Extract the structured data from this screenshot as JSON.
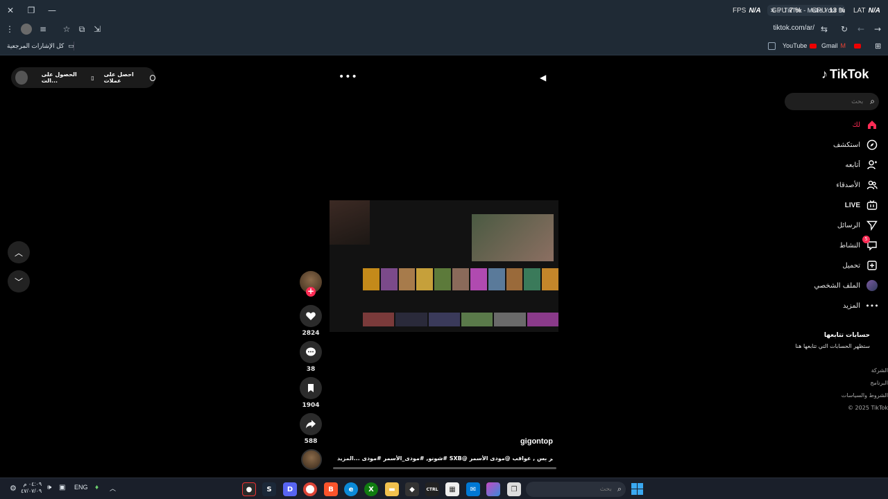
{
  "window": {
    "tab_title": "TikTok - Make Your Day",
    "overlay": {
      "fps_label": "FPS",
      "fps_value": "N/A",
      "gpu_label": "GPU",
      "gpu_value": "7 %",
      "cpu_label": "CPU",
      "cpu_value": "13 %",
      "lat_label": "LAT",
      "lat_value": "N/A"
    }
  },
  "toolbar": {
    "url": "tiktok.com/ar/"
  },
  "bookmarks": {
    "all_bookmarks": "كل الإشارات المرجعية",
    "youtube": "YouTube",
    "gmail": "Gmail"
  },
  "tiktok": {
    "logo": "TikTok",
    "search_placeholder": "بحث",
    "promo": {
      "get_coins": "احصل على عملات",
      "get_app": "الحصول على الت..."
    },
    "nav": [
      {
        "label": "لك",
        "icon": "home-icon"
      },
      {
        "label": "استكشف",
        "icon": "compass-icon"
      },
      {
        "label": "أتابعه",
        "icon": "following-icon"
      },
      {
        "label": "الأصدقاء",
        "icon": "friends-icon"
      },
      {
        "label": "LIVE",
        "icon": "live-icon"
      },
      {
        "label": "الرسائل",
        "icon": "messages-icon"
      },
      {
        "label": "النشاط",
        "icon": "activity-icon",
        "badge": "5"
      },
      {
        "label": "تحميل",
        "icon": "upload-icon"
      },
      {
        "label": "الملف الشخصي",
        "icon": "profile-icon"
      },
      {
        "label": "المزيد",
        "icon": "more-icon"
      }
    ],
    "following": {
      "title": "حسابات تتابعها",
      "subtitle": "ستظهر الحسابات التي تتابعها هنا"
    },
    "footer": {
      "company": "الشركة",
      "program": "البرنامج",
      "terms": "الشروط والسياسات",
      "copyright": "© 2025 TikTok"
    },
    "video": {
      "author": "gigontop",
      "caption": "تأخر بس , عواقب @مودى الأسمر @SXB  #شونو, #مودى_الأسمر #مودى ...",
      "more": "المزيد",
      "likes": "2824",
      "comments": "38",
      "saves": "1904",
      "shares": "588"
    }
  },
  "taskbar": {
    "search_placeholder": "بحث",
    "lang": "ENG",
    "time": "٠٤:٠٩ م",
    "date": "٤٧/٠٧/٠٩",
    "colors": {
      "accent": "#fe2c55",
      "taskbar": "#1a1f2a"
    }
  }
}
